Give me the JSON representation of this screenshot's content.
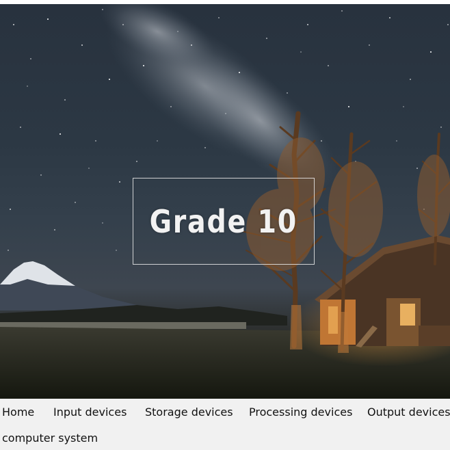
{
  "hero": {
    "title": "Grade 10",
    "background_scene": "night-sky-milky-way-cabin"
  },
  "nav": {
    "items": [
      {
        "label": "Home"
      },
      {
        "label": "Input devices"
      },
      {
        "label": "Storage devices"
      },
      {
        "label": "Processing devices"
      },
      {
        "label": "Output devices"
      },
      {
        "label": "computer system"
      }
    ]
  },
  "colors": {
    "nav_background": "#f1f1f1",
    "nav_text": "#111111",
    "title_text": "#f2f2f2"
  }
}
